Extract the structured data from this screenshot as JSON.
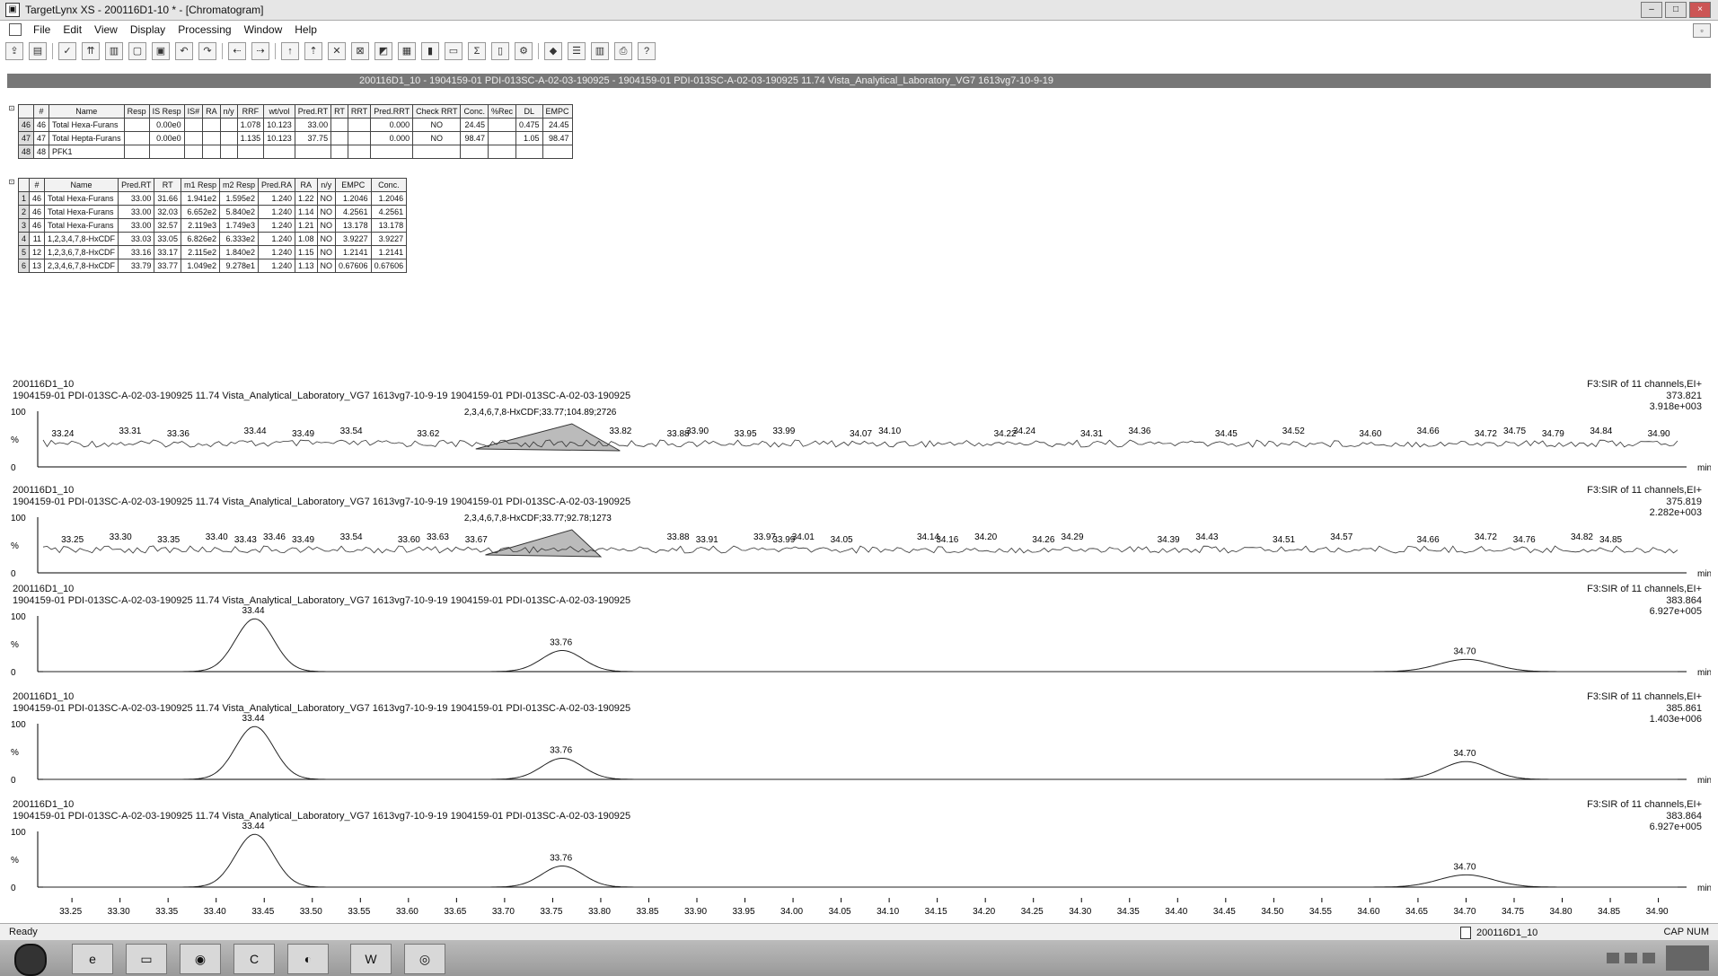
{
  "window": {
    "title": "TargetLynx XS - 200116D1-10 * - [Chromatogram]",
    "min": "–",
    "max": "□",
    "close": "×"
  },
  "menu": [
    "File",
    "Edit",
    "View",
    "Display",
    "Processing",
    "Window",
    "Help"
  ],
  "info_strip": "200116D1_10 - 1904159-01 PDI-013SC-A-02-03-190925 - 1904159-01 PDI-013SC-A-02-03-190925 11.74 Vista_Analytical_Laboratory_VG7 1613vg7-10-9-19",
  "summary_table": {
    "headers": [
      "",
      "#",
      "Name",
      "Resp",
      "IS Resp",
      "IS#",
      "RA",
      "n/y",
      "RRF",
      "wt/vol",
      "Pred.RT",
      "RT",
      "RRT",
      "Pred.RRT",
      "Check RRT",
      "Conc.",
      "%Rec",
      "DL",
      "EMPC"
    ],
    "rows": [
      [
        "46",
        "46",
        "Total Hexa-Furans",
        "",
        "0.00e0",
        "",
        "",
        "",
        "1.078",
        "10.123",
        "33.00",
        "",
        "",
        "0.000",
        "NO",
        "24.45",
        "",
        "0.475",
        "24.45"
      ],
      [
        "47",
        "47",
        "Total Hepta-Furans",
        "",
        "0.00e0",
        "",
        "",
        "",
        "1.135",
        "10.123",
        "37.75",
        "",
        "",
        "0.000",
        "NO",
        "98.47",
        "",
        "1.05",
        "98.47"
      ],
      [
        "48",
        "48",
        "PFK1",
        "",
        "",
        "",
        "",
        "",
        "",
        "",
        "",
        "",
        "",
        "",
        "",
        "",
        "",
        "",
        ""
      ]
    ]
  },
  "peak_table": {
    "headers": [
      "",
      "#",
      "Name",
      "Pred.RT",
      "RT",
      "m1 Resp",
      "m2 Resp",
      "Pred.RA",
      "RA",
      "n/y",
      "EMPC",
      "Conc."
    ],
    "rows": [
      [
        "1",
        "46",
        "Total Hexa-Furans",
        "33.00",
        "31.66",
        "1.941e2",
        "1.595e2",
        "1.240",
        "1.22",
        "NO",
        "1.2046",
        "1.2046"
      ],
      [
        "2",
        "46",
        "Total Hexa-Furans",
        "33.00",
        "32.03",
        "6.652e2",
        "5.840e2",
        "1.240",
        "1.14",
        "NO",
        "4.2561",
        "4.2561"
      ],
      [
        "3",
        "46",
        "Total Hexa-Furans",
        "33.00",
        "32.57",
        "2.119e3",
        "1.749e3",
        "1.240",
        "1.21",
        "NO",
        "13.178",
        "13.178"
      ],
      [
        "4",
        "11",
        "1,2,3,4,7,8-HxCDF",
        "33.03",
        "33.05",
        "6.826e2",
        "6.333e2",
        "1.240",
        "1.08",
        "NO",
        "3.9227",
        "3.9227"
      ],
      [
        "5",
        "12",
        "1,2,3,6,7,8-HxCDF",
        "33.16",
        "33.17",
        "2.115e2",
        "1.840e2",
        "1.240",
        "1.15",
        "NO",
        "1.2141",
        "1.2141"
      ],
      [
        "6",
        "13",
        "2,3,4,6,7,8-HxCDF",
        "33.79",
        "33.77",
        "1.049e2",
        "9.278e1",
        "1.240",
        "1.13",
        "NO",
        "0.67606",
        "0.67606"
      ]
    ]
  },
  "chart_data": {
    "type": "line",
    "xlabel": "min",
    "xlim": [
      33.22,
      34.92
    ],
    "x_ticks": [
      "33.25",
      "33.30",
      "33.35",
      "33.40",
      "33.45",
      "33.50",
      "33.55",
      "33.60",
      "33.65",
      "33.70",
      "33.75",
      "33.80",
      "33.85",
      "33.90",
      "33.95",
      "34.00",
      "34.05",
      "34.10",
      "34.15",
      "34.20",
      "34.25",
      "34.30",
      "34.35",
      "34.40",
      "34.45",
      "34.50",
      "34.55",
      "34.60",
      "34.65",
      "34.70",
      "34.75",
      "34.80",
      "34.85",
      "34.90"
    ],
    "y_ticks": [
      "100",
      "%",
      "0"
    ],
    "traces": [
      {
        "sample": "200116D1_10",
        "desc": "1904159-01 PDI-013SC-A-02-03-190925 11.74 Vista_Analytical_Laboratory_VG7 1613vg7-10-9-19 1904159-01 PDI-013SC-A-02-03-190925",
        "function": "F3:SIR of 11 channels,EI+",
        "mass": "373.821",
        "intensity": "3.918e+003",
        "peak_annotation": "2,3,4,6,7,8-HxCDF;33.77;104.89;2726",
        "kind": "noise",
        "peaks": [
          {
            "rt": 33.24
          },
          {
            "rt": 33.31
          },
          {
            "rt": 33.36
          },
          {
            "rt": 33.44
          },
          {
            "rt": 33.49
          },
          {
            "rt": 33.54
          },
          {
            "rt": 33.62
          },
          {
            "rt": 33.82
          },
          {
            "rt": 33.88
          },
          {
            "rt": 33.9
          },
          {
            "rt": 33.95
          },
          {
            "rt": 33.99
          },
          {
            "rt": 34.07
          },
          {
            "rt": 34.1
          },
          {
            "rt": 34.22
          },
          {
            "rt": 34.24
          },
          {
            "rt": 34.31
          },
          {
            "rt": 34.36
          },
          {
            "rt": 34.45
          },
          {
            "rt": 34.52
          },
          {
            "rt": 34.6
          },
          {
            "rt": 34.66
          },
          {
            "rt": 34.72
          },
          {
            "rt": 34.75
          },
          {
            "rt": 34.79
          },
          {
            "rt": 34.84
          },
          {
            "rt": 34.9
          }
        ],
        "label_strings": [
          "33.24",
          "33.31",
          "33.36",
          "33.44",
          "33.49",
          "33.54",
          "33.62",
          "33.82",
          "33.88",
          "33.90",
          "33.95",
          "33.99",
          "34.07",
          "34.10",
          "34.22",
          "34.24",
          "34.31",
          "34.36",
          "34.45",
          "34.52",
          "34.60",
          "34.66",
          "34.72",
          "34.75",
          "34.79",
          "34.84",
          "34.90"
        ],
        "shaded": [
          33.67,
          33.82
        ],
        "big_peak": 33.77
      },
      {
        "sample": "200116D1_10",
        "desc": "1904159-01 PDI-013SC-A-02-03-190925 11.74 Vista_Analytical_Laboratory_VG7 1613vg7-10-9-19 1904159-01 PDI-013SC-A-02-03-190925",
        "function": "F3:SIR of 11 channels,EI+",
        "mass": "375.819",
        "intensity": "2.282e+003",
        "peak_annotation": "2,3,4,6,7,8-HxCDF;33.77;92.78;1273",
        "kind": "noise",
        "label_strings": [
          "33.25",
          "33.30",
          "33.35",
          "33.40",
          "33.43",
          "33.46",
          "33.49",
          "33.54",
          "33.60",
          "33.63",
          "33.67",
          "33.88",
          "33.91",
          "33.97",
          "33.99",
          "34.01",
          "34.05",
          "34.14",
          "34.16",
          "34.20",
          "34.26",
          "34.29",
          "34.39",
          "34.43",
          "34.51",
          "34.57",
          "34.66",
          "34.72",
          "34.76",
          "34.82",
          "34.85"
        ],
        "shaded": [
          33.68,
          33.8
        ],
        "big_peak": 33.77
      },
      {
        "sample": "200116D1_10",
        "desc": "1904159-01 PDI-013SC-A-02-03-190925 11.74 Vista_Analytical_Laboratory_VG7 1613vg7-10-9-19 1904159-01 PDI-013SC-A-02-03-190925",
        "function": "F3:SIR of 11 channels,EI+",
        "mass": "383.864",
        "intensity": "6.927e+005",
        "kind": "peaks",
        "gpeaks": [
          {
            "rt": 33.44,
            "h": 0.95,
            "w": 0.028,
            "label": "33.44"
          },
          {
            "rt": 33.76,
            "h": 0.38,
            "w": 0.03,
            "label": "33.76"
          },
          {
            "rt": 34.7,
            "h": 0.22,
            "w": 0.04,
            "label": "34.70"
          }
        ]
      },
      {
        "sample": "200116D1_10",
        "desc": "1904159-01 PDI-013SC-A-02-03-190925 11.74 Vista_Analytical_Laboratory_VG7 1613vg7-10-9-19 1904159-01 PDI-013SC-A-02-03-190925",
        "function": "F3:SIR of 11 channels,EI+",
        "mass": "385.861",
        "intensity": "1.403e+006",
        "kind": "peaks",
        "gpeaks": [
          {
            "rt": 33.44,
            "h": 0.95,
            "w": 0.028,
            "label": "33.44"
          },
          {
            "rt": 33.76,
            "h": 0.38,
            "w": 0.03,
            "label": "33.76"
          },
          {
            "rt": 34.7,
            "h": 0.32,
            "w": 0.035,
            "label": "34.70"
          }
        ]
      },
      {
        "sample": "200116D1_10",
        "desc": "1904159-01 PDI-013SC-A-02-03-190925 11.74 Vista_Analytical_Laboratory_VG7 1613vg7-10-9-19 1904159-01 PDI-013SC-A-02-03-190925",
        "function": "F3:SIR of 11 channels,EI+",
        "mass": "383.864",
        "intensity": "6.927e+005",
        "kind": "peaks",
        "gpeaks": [
          {
            "rt": 33.44,
            "h": 0.95,
            "w": 0.028,
            "label": "33.44"
          },
          {
            "rt": 33.76,
            "h": 0.38,
            "w": 0.03,
            "label": "33.76"
          },
          {
            "rt": 34.7,
            "h": 0.22,
            "w": 0.04,
            "label": "34.70"
          }
        ]
      }
    ]
  },
  "status": {
    "ready": "Ready",
    "file": "200116D1_10",
    "caps": "CAP NUM"
  }
}
